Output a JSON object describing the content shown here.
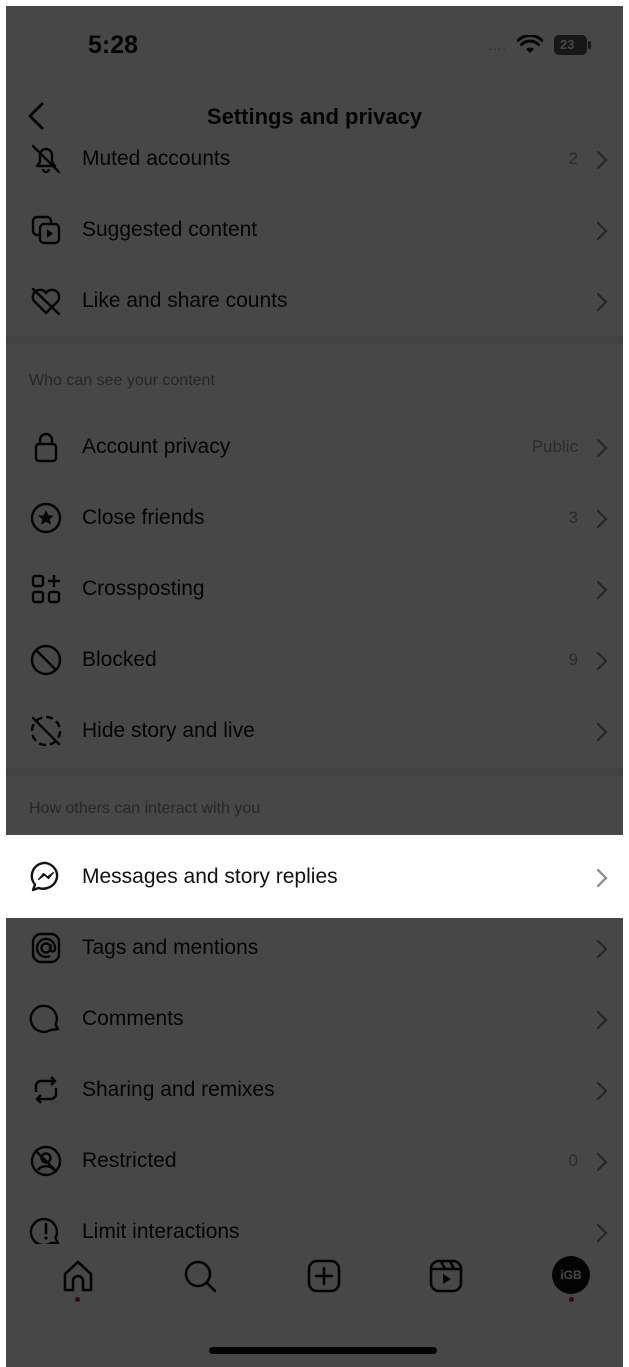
{
  "status": {
    "time": "5:28",
    "signal": "....",
    "battery": "23"
  },
  "nav": {
    "title": "Settings and privacy"
  },
  "rows_top": [
    {
      "label": "Muted accounts",
      "value": "2",
      "icon": "bell-off-icon"
    },
    {
      "label": "Suggested content",
      "value": "",
      "icon": "suggested-content-icon"
    },
    {
      "label": "Like and share counts",
      "value": "",
      "icon": "heart-off-icon"
    }
  ],
  "section_visibility": "Who can see your content",
  "rows_visibility": [
    {
      "label": "Account privacy",
      "value": "Public",
      "icon": "lock-icon"
    },
    {
      "label": "Close friends",
      "value": "3",
      "icon": "star-circle-icon"
    },
    {
      "label": "Crossposting",
      "value": "",
      "icon": "grid-plus-icon"
    },
    {
      "label": "Blocked",
      "value": "9",
      "icon": "blocked-icon"
    },
    {
      "label": "Hide story and live",
      "value": "",
      "icon": "story-off-icon"
    }
  ],
  "section_interact": "How others can interact with you",
  "rows_interact": [
    {
      "label": "Messages and story replies",
      "value": "",
      "icon": "messenger-icon"
    },
    {
      "label": "Tags and mentions",
      "value": "",
      "icon": "at-sign-icon"
    },
    {
      "label": "Comments",
      "value": "",
      "icon": "comment-icon"
    },
    {
      "label": "Sharing and remixes",
      "value": "",
      "icon": "repost-icon"
    },
    {
      "label": "Restricted",
      "value": "0",
      "icon": "restricted-icon"
    },
    {
      "label": "Limit interactions",
      "value": "",
      "icon": "limit-icon"
    }
  ],
  "tabbar": {
    "avatar_text": "iGB",
    "tabs": [
      "home-icon",
      "search-icon",
      "create-icon",
      "reels-icon",
      "profile-avatar"
    ]
  },
  "colors": {
    "overlay": "#000000b8",
    "notification_dot": "#e0103a"
  }
}
